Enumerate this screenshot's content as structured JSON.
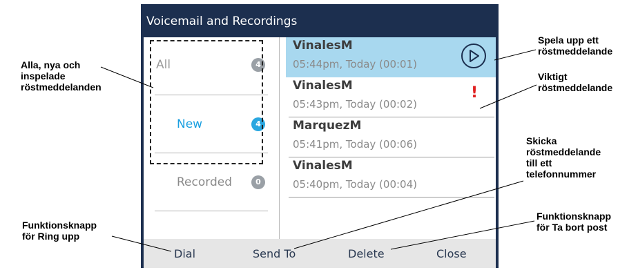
{
  "title": "Voicemail and Recordings",
  "filters": [
    {
      "label": "All",
      "count": "4",
      "color": "#9aa0a6",
      "label_color": "#9a9a9a"
    },
    {
      "label": "New",
      "count": "4",
      "color": "#2aa7e0",
      "label_color": "#1a9fe0"
    },
    {
      "label": "Recorded",
      "count": "0",
      "color": "#9aa0a6",
      "label_color": "#8a8a8a"
    }
  ],
  "messages": [
    {
      "name": "VinalesM",
      "meta": "05:44pm, Today (00:01)",
      "selected": true
    },
    {
      "name": "VinalesM",
      "meta": "05:43pm, Today (00:02)",
      "urgent": true
    },
    {
      "name": "MarquezM",
      "meta": "05:41pm, Today (00:06)"
    },
    {
      "name": "VinalesM",
      "meta": "05:40pm, Today (00:04)"
    }
  ],
  "urgent_symbol": "!",
  "softkeys": [
    "Dial",
    "Send To",
    "Delete",
    "Close"
  ],
  "annotations": {
    "filters": "Alla, nya och\ninspelade\nröstmeddelanden",
    "play": "Spela upp ett\nröstmeddelande",
    "urgent": "Viktigt\nröstmeddelande",
    "send": "Skicka\nröstmeddelande\ntill ett\ntelefonnummer",
    "dial": "Funktionsknapp\nför Ring upp",
    "delete": "Funktionsknapp\nför Ta bort post"
  },
  "colors": {
    "header": "#1c2f4f",
    "selection": "#a8d8ef",
    "urgent": "#e02020",
    "softbar": "#e6e6e6"
  }
}
